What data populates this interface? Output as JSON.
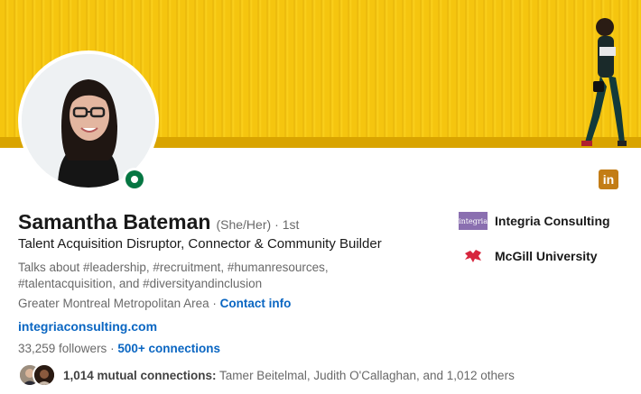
{
  "banner": {
    "description_icon": "yellow-wall-banner"
  },
  "profile": {
    "name": "Samantha Bateman",
    "pronouns": "(She/Her)",
    "degree": "· 1st",
    "headline": "Talent Acquisition Disruptor, Connector & Community Builder",
    "talks_about": "Talks about #leadership, #recruitment, #humanresources, #talentacquisition, and #diversityandinclusion",
    "location": "Greater Montreal Metropolitan Area",
    "separator": " · ",
    "contact_info": "Contact info",
    "website": "integriaconsulting.com",
    "followers": "33,259 followers",
    "connections_sep": " · ",
    "connections": "500+ connections",
    "mutual_count": "1,014 mutual connections:",
    "mutual_names": " Tamer Beitelmal, Judith O'Callaghan, and 1,012 others",
    "linkedin_badge": "in"
  },
  "side": {
    "company": {
      "logo_text": "integria",
      "label": "Integria Consulting"
    },
    "school": {
      "label": "McGill University"
    }
  },
  "colors": {
    "banner_yellow": "#f5c50f",
    "link_blue": "#0a66c2",
    "online_green": "#057642",
    "linkedin_badge": "#c37d16",
    "mcgill_red": "#d7263d"
  }
}
